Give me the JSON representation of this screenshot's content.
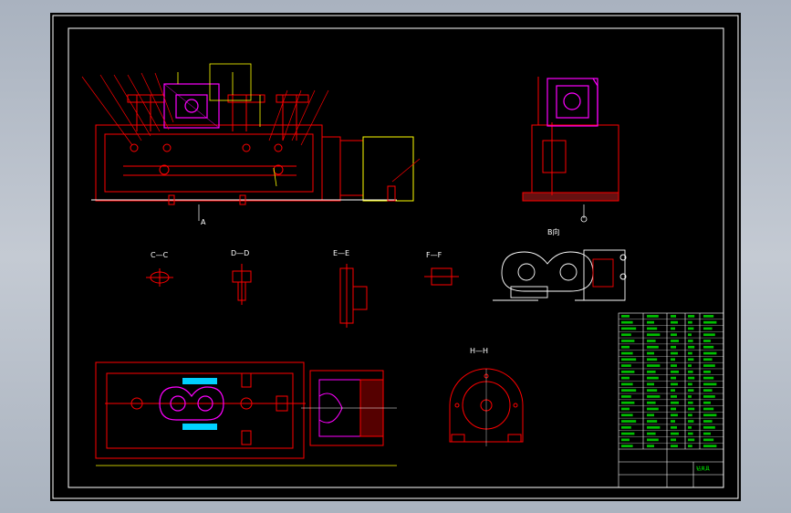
{
  "section_labels": {
    "cc": "C—C",
    "dd": "D—D",
    "ee": "E—E",
    "ff": "F—F",
    "hh": "H—H",
    "view_a": "A",
    "b_view": "B向"
  },
  "title_block": {
    "name": "钻夹具"
  },
  "colors": {
    "background": "#000000",
    "frame": "#ffffff",
    "outline": "#ff0000",
    "dimension": "#ffff00",
    "part": "#ff00ff",
    "hatch": "#00ffff",
    "table_text": "#00ff00"
  }
}
